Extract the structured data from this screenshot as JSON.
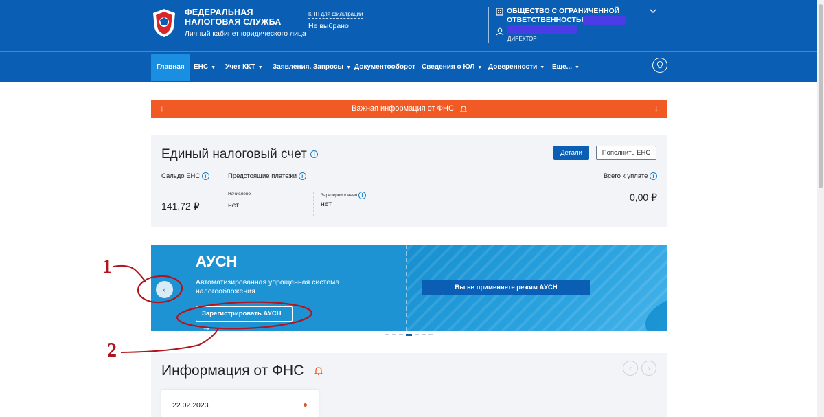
{
  "header": {
    "org_line1": "ФЕДЕРАЛЬНАЯ",
    "org_line2": "НАЛОГОВАЯ СЛУЖБА",
    "cabinet": "Личный кабинет юридического лица",
    "kpp_label": "КПП для фильтрации",
    "kpp_value": "Не выбрано",
    "company_name": "ОБЩЕСТВО С ОГРАНИЧЕННОЙ ОТВЕТСТВЕННОСТЬЮ",
    "role": "ДИРЕКТОР"
  },
  "nav": {
    "items": [
      {
        "label": "Главная"
      },
      {
        "label": "ЕНС"
      },
      {
        "label": "Учет ККТ"
      },
      {
        "label": "Заявления. Запросы"
      },
      {
        "label": "Документооборот"
      },
      {
        "label": "Сведения о ЮЛ"
      },
      {
        "label": "Доверенности"
      },
      {
        "label": "Еще..."
      }
    ]
  },
  "notice": {
    "text": "Важная информация от ФНС"
  },
  "ens": {
    "title": "Единый налоговый счет",
    "details_button": "Детали",
    "topup_button": "Пополнить ЕНС",
    "saldo_label": "Сальдо ЕНС",
    "saldo_value": "141,72 ₽",
    "upcoming_label": "Предстоящие платежи",
    "accrued_label": "Начислено",
    "accrued_value": "нет",
    "reserved_label": "Зарезервировано",
    "reserved_value": "нет",
    "total_label": "Всего к уплате",
    "total_value": "0,00 ₽"
  },
  "banner": {
    "title": "АУСН",
    "description": "Автоматизированная упрощённая система налогообложения",
    "register_button": "Зарегистрировать АУСН",
    "status": "Вы не применяете режим АУСН",
    "active_slide": 4,
    "slide_count": 7
  },
  "fns_info": {
    "title": "Информация от ФНС",
    "news": [
      {
        "date": "22.02.2023"
      }
    ]
  },
  "annotations": {
    "marker1": "1",
    "marker2": "2"
  }
}
